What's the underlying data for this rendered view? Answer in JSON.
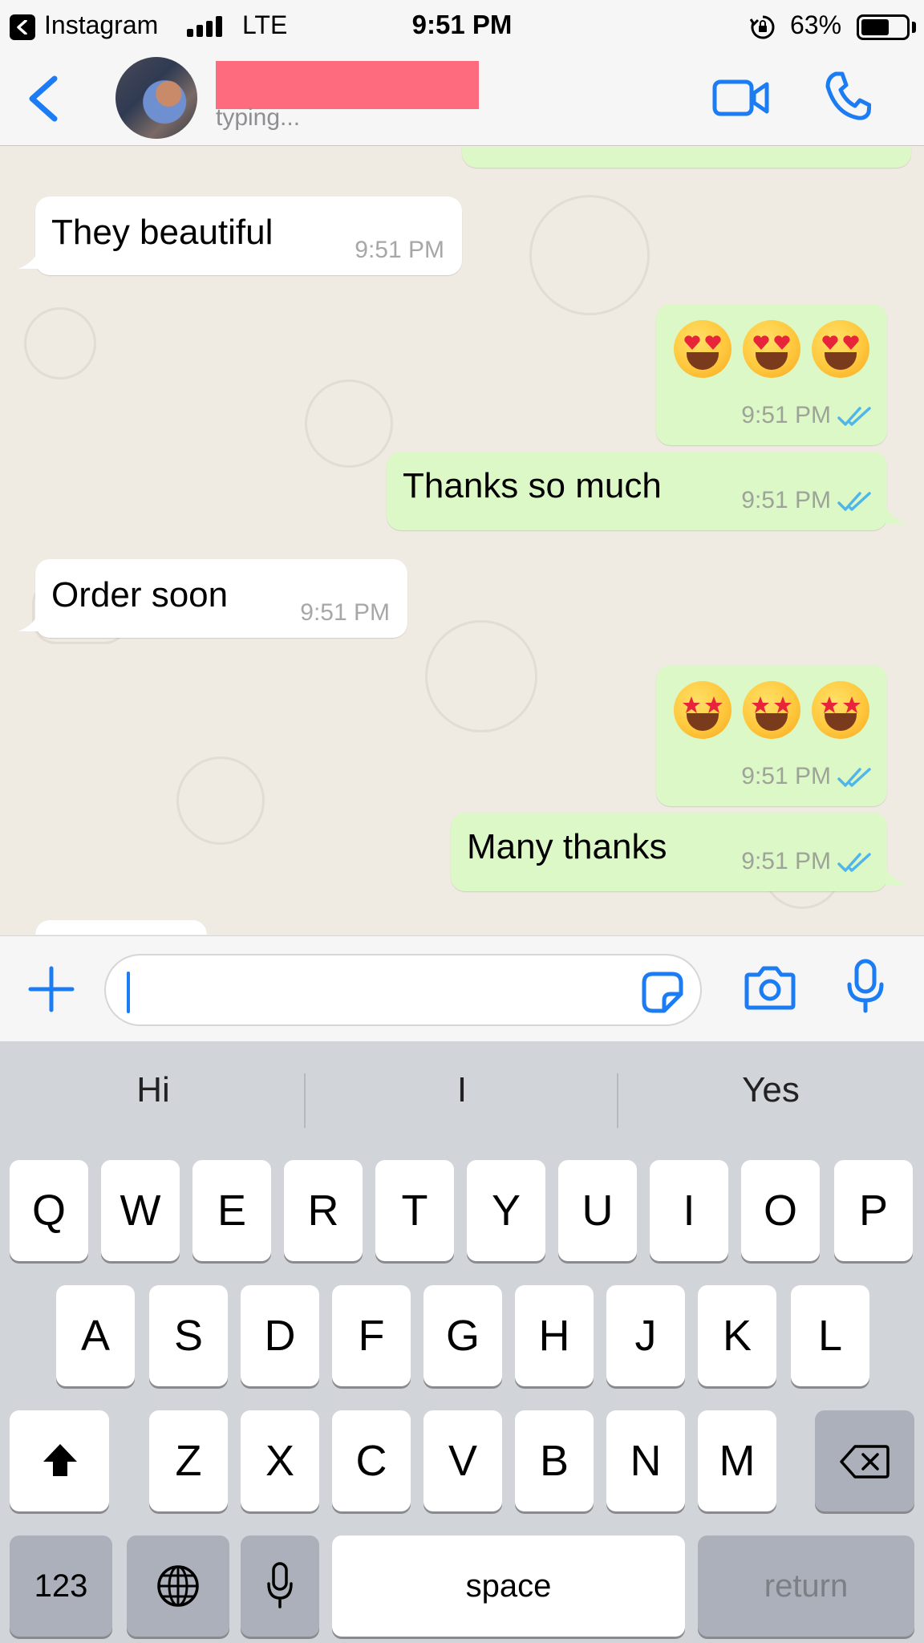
{
  "status_bar": {
    "back_app": "Instagram",
    "network": "LTE",
    "time": "9:51 PM",
    "battery_percent": "63%",
    "battery_level": 0.63
  },
  "header": {
    "contact_status": "typing...",
    "back_icon": "chevron-left-icon",
    "video_icon": "video-camera-icon",
    "call_icon": "phone-icon"
  },
  "messages": [
    {
      "direction": "incoming",
      "text": "They beautiful",
      "time": "9:51 PM"
    },
    {
      "direction": "outgoing",
      "emoji": [
        "😍",
        "😍",
        "😍"
      ],
      "time": "9:51 PM",
      "read": true
    },
    {
      "direction": "outgoing",
      "text": "Thanks so much",
      "time": "9:51 PM",
      "read": true
    },
    {
      "direction": "incoming",
      "text": "Order soon",
      "time": "9:51 PM"
    },
    {
      "direction": "outgoing",
      "emoji": [
        "🤩",
        "🤩",
        "🤩"
      ],
      "time": "9:51 PM",
      "read": true
    },
    {
      "direction": "outgoing",
      "text": "Many thanks",
      "time": "9:51 PM",
      "read": true
    }
  ],
  "input_bar": {
    "value": "",
    "icons": [
      "plus-icon",
      "sticker-icon",
      "camera-icon",
      "microphone-icon"
    ]
  },
  "keyboard": {
    "suggestions": [
      "Hi",
      "I",
      "Yes"
    ],
    "row1": [
      "Q",
      "W",
      "E",
      "R",
      "T",
      "Y",
      "U",
      "I",
      "O",
      "P"
    ],
    "row2": [
      "A",
      "S",
      "D",
      "F",
      "G",
      "H",
      "J",
      "K",
      "L"
    ],
    "row3": [
      "Z",
      "X",
      "C",
      "V",
      "B",
      "N",
      "M"
    ],
    "numbers_key": "123",
    "space_key": "space",
    "return_key": "return"
  },
  "colors": {
    "accent": "#1c7cf4",
    "outgoing_bubble": "#dcf8c6",
    "incoming_bubble": "#ffffff",
    "chat_background": "#efeae2",
    "read_ticks": "#4fb6ec",
    "redaction": "#ff6b7e"
  }
}
